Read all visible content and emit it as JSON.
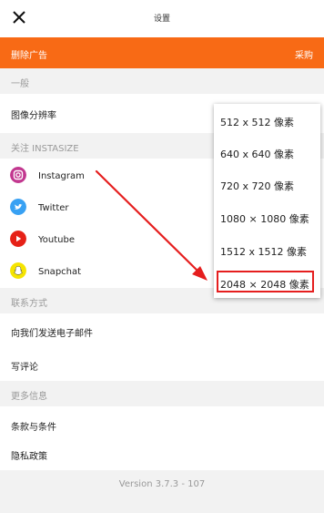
{
  "header": {
    "title": "设置",
    "close_icon": "close-icon"
  },
  "banner": {
    "left": "删除广告",
    "right": "采购",
    "color": "#f86a15"
  },
  "sections": {
    "general": "一般",
    "follow": "关注 INSTASIZE",
    "contact": "联系方式",
    "more": "更多信息"
  },
  "items": {
    "resolution": "图像分辨率",
    "instagram": "Instagram",
    "twitter": "Twitter",
    "youtube": "Youtube",
    "snapchat": "Snapchat",
    "email": "向我们发送电子邮件",
    "review": "写评论",
    "terms": "条款与条件",
    "privacy": "隐私政策"
  },
  "version": "Version 3.7.3 - 107",
  "resolution_options": [
    "512 x 512 像素",
    "640 x 640 像素",
    "720 x 720 像素",
    "1080 × 1080 像素",
    "1512 x 1512 像素",
    "2048 × 2048 像素"
  ],
  "highlight_color": "#e51e1e"
}
